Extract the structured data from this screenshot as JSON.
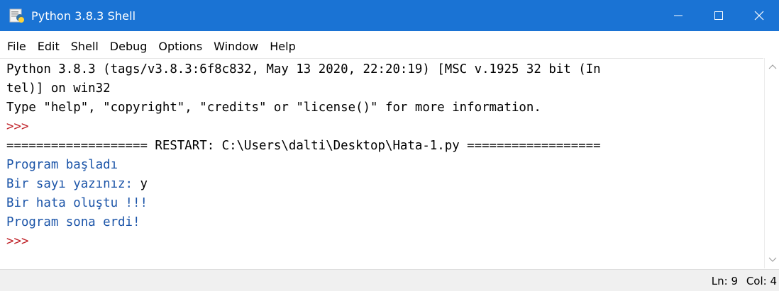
{
  "window": {
    "title": "Python 3.8.3 Shell",
    "controls": {
      "minimize": "—",
      "maximize": "☐",
      "close": "✕"
    },
    "titlebar_color": "#1a73d4"
  },
  "menu": [
    "File",
    "Edit",
    "Shell",
    "Debug",
    "Options",
    "Window",
    "Help"
  ],
  "shell": {
    "banner_line1": "Python 3.8.3 (tags/v3.8.3:6f8c832, May 13 2020, 22:20:19) [MSC v.1925 32 bit (In",
    "banner_line2": "tel)] on win32",
    "banner_line3": "Type \"help\", \"copyright\", \"credits\" or \"license()\" for more information.",
    "prompt1": ">>>",
    "restart_line": "=================== RESTART: C:\\Users\\dalti\\Desktop\\Hata-1.py ==================",
    "out1": "Program başladı",
    "out2_prompt": "Bir sayı yazınız: ",
    "out2_input": "y",
    "out3": "Bir hata oluştu !!!",
    "out4": "Program sona erdi!",
    "prompt2": ">>>"
  },
  "status": {
    "line": "Ln: 9",
    "col": "Col: 4"
  },
  "colors": {
    "prompt": "#c1272d",
    "output": "#1b54a8"
  }
}
